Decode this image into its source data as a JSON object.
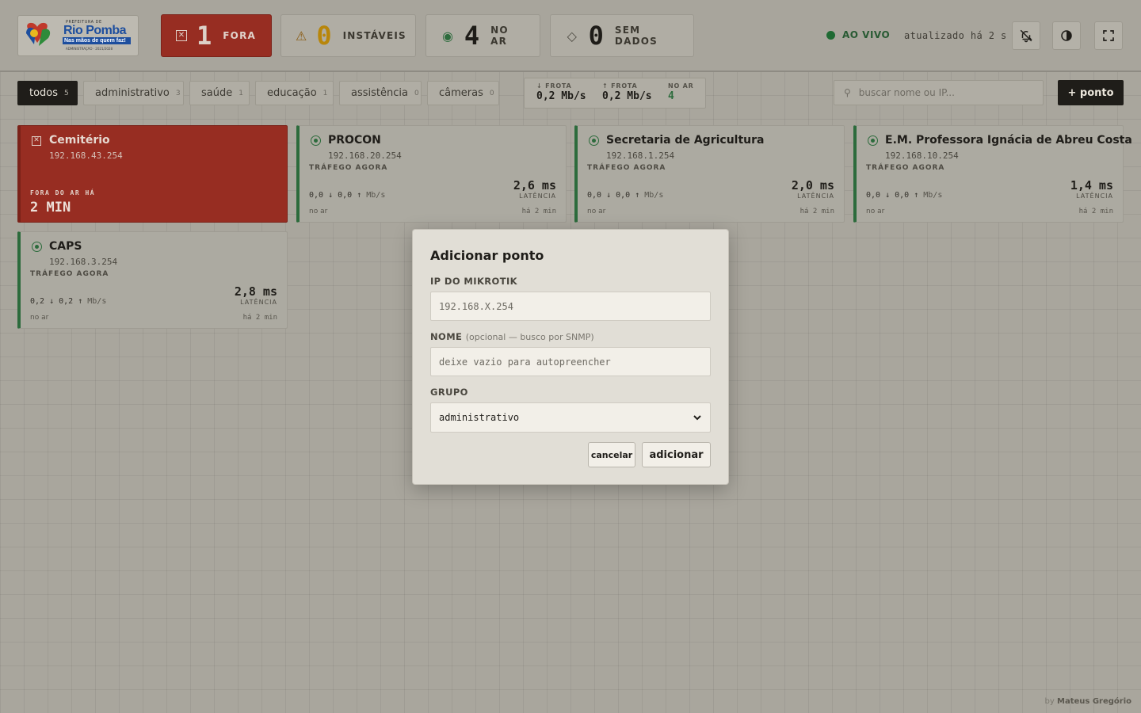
{
  "header": {
    "logo": {
      "text_top": "PREFEITURA DE",
      "name": "Rio Pomba",
      "slogan": "Nas mãos de quem faz!",
      "admin": "ADMINISTRAÇÃO · 2021/2028"
    },
    "stats": [
      {
        "icon": "x-square",
        "value": "1",
        "label": "FORA"
      },
      {
        "icon": "warning-triangle",
        "value": "0",
        "label": "INSTÁVEIS"
      },
      {
        "icon": "radio-dot",
        "value": "4",
        "label": "NO AR"
      },
      {
        "icon": "diamond",
        "value": "0",
        "label": "SEM DADOS"
      }
    ],
    "live_label": "AO VIVO",
    "updated_text": "atualizado há 2 s"
  },
  "filters": [
    {
      "label": "todos",
      "count": "5"
    },
    {
      "label": "administrativo",
      "count": "3"
    },
    {
      "label": "saúde",
      "count": "1"
    },
    {
      "label": "educação",
      "count": "1"
    },
    {
      "label": "assistência",
      "count": "0"
    },
    {
      "label": "câmeras",
      "count": "0"
    }
  ],
  "fleet": {
    "down_label": "↓ FROTA",
    "down_value": "0,2 Mb/s",
    "up_label": "↑ FROTA",
    "up_value": "0,2 Mb/s",
    "online_label": "NO AR",
    "online_value": "4"
  },
  "search": {
    "placeholder": "buscar nome ou IP..."
  },
  "add_button": "+ ponto",
  "cards": [
    {
      "name": "Cemitério",
      "ip": "192.168.43.254",
      "down_label": "FORA DO AR HÁ",
      "down_value": "2 MIN"
    },
    {
      "name": "PROCON",
      "ip": "192.168.20.254",
      "traffic_label": "TRÁFEGO AGORA",
      "rates": "0,0 ↓ 0,0 ↑",
      "unit": "Mb/s",
      "latency": "2,6 ms",
      "latency_label": "LATÊNCIA",
      "status": "no ar",
      "ago": "há 2 min"
    },
    {
      "name": "Secretaria de Agricultura",
      "ip": "192.168.1.254",
      "traffic_label": "TRÁFEGO AGORA",
      "rates": "0,0 ↓ 0,0 ↑",
      "unit": "Mb/s",
      "latency": "2,0 ms",
      "latency_label": "LATÊNCIA",
      "status": "no ar",
      "ago": "há 2 min"
    },
    {
      "name": "E.M. Professora Ignácia de Abreu Costa",
      "ip": "192.168.10.254",
      "traffic_label": "TRÁFEGO AGORA",
      "rates": "0,0 ↓ 0,0 ↑",
      "unit": "Mb/s",
      "latency": "1,4 ms",
      "latency_label": "LATÊNCIA",
      "status": "no ar",
      "ago": "há 2 min"
    },
    {
      "name": "CAPS",
      "ip": "192.168.3.254",
      "traffic_label": "TRÁFEGO AGORA",
      "rates": "0,2 ↓ 0,2 ↑",
      "unit": "Mb/s",
      "latency": "2,8 ms",
      "latency_label": "LATÊNCIA",
      "status": "no ar",
      "ago": "há 2 min"
    }
  ],
  "modal": {
    "title": "Adicionar ponto",
    "ip_label": "IP DO MIKROTIK",
    "ip_placeholder": "192.168.X.254",
    "name_label": "NOME",
    "name_hint": "(opcional — busco por SNMP)",
    "name_placeholder": "deixe vazio para autopreencher",
    "group_label": "GRUPO",
    "group_value": "administrativo",
    "cancel": "cancelar",
    "add": "adicionar"
  },
  "credit": {
    "prefix": "by",
    "author": "Mateus Gregório"
  },
  "colors": {
    "down": "#972d22",
    "online": "#2c6b3c",
    "warning": "#b8860b",
    "dark": "#1f1d19"
  }
}
